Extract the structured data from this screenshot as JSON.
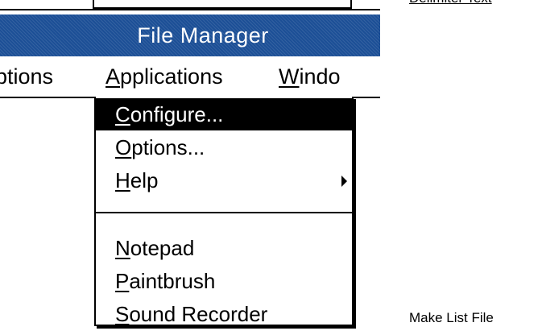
{
  "window": {
    "title": "File Manager"
  },
  "menubar": {
    "items": [
      {
        "label_pre": "",
        "label_ul": "",
        "label_post": "ptions"
      },
      {
        "label_pre": "",
        "label_ul": "A",
        "label_post": "pplications"
      },
      {
        "label_pre": "",
        "label_ul": "W",
        "label_post": "indo"
      }
    ]
  },
  "dropdown": {
    "items": [
      {
        "ul": "C",
        "rest": "onfigure...",
        "selected": true
      },
      {
        "ul": "O",
        "rest": "ptions..."
      },
      {
        "ul": "H",
        "rest": "elp",
        "submenu": true
      },
      {
        "ul": "N",
        "rest": "otepad"
      },
      {
        "ul": "P",
        "rest": "aintbrush"
      },
      {
        "ul": "S",
        "rest": "ound Recorder"
      }
    ]
  },
  "side": {
    "top_link": "Delimiter Text",
    "bottom_text": "Make List File"
  }
}
